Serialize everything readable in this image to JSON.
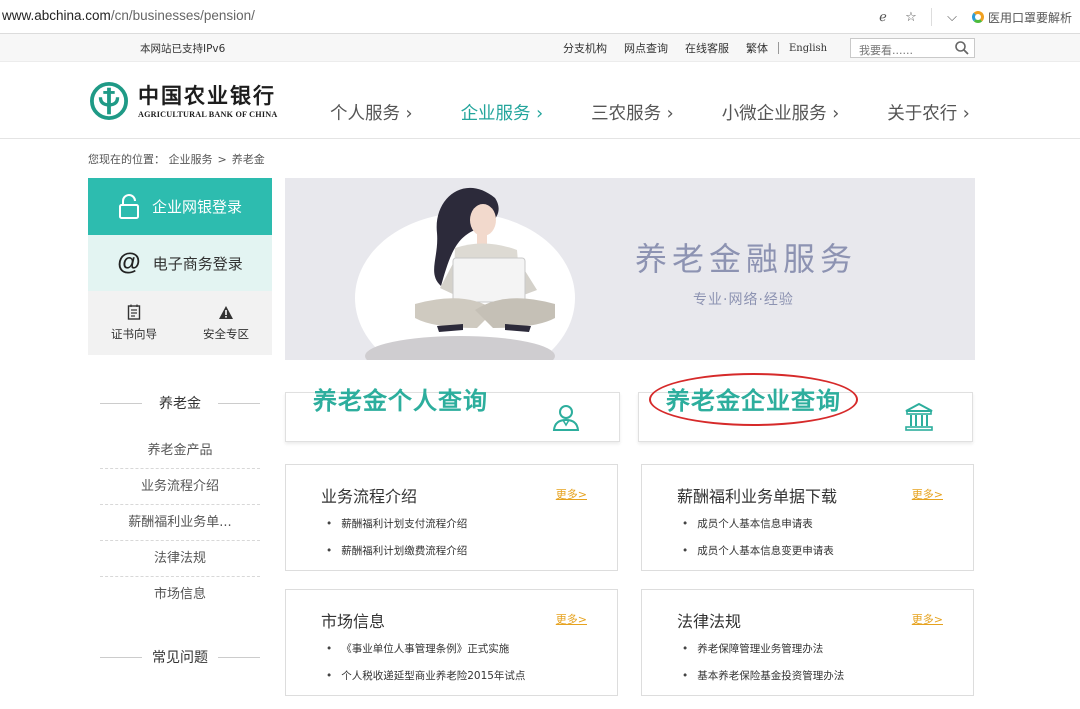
{
  "browser": {
    "url_host": "www.abchina.com",
    "url_path": "/cn/businesses/pension/",
    "search_hint": "医用口罩要解析"
  },
  "topbar": {
    "ipv6": "本网站已支持IPv6",
    "links": [
      "分支机构",
      "网点查询",
      "在线客服",
      "繁体"
    ],
    "english": "English",
    "search_placeholder": "我要看......"
  },
  "header": {
    "logo_cn": "中国农业银行",
    "logo_en": "AGRICULTURAL BANK OF CHINA",
    "nav": [
      {
        "label": "个人服务 ›",
        "active": false
      },
      {
        "label": "企业服务 ›",
        "active": true
      },
      {
        "label": "三农服务 ›",
        "active": false
      },
      {
        "label": "小微企业服务 ›",
        "active": false
      },
      {
        "label": "关于农行 ›",
        "active": false
      }
    ]
  },
  "breadcrumb": {
    "prefix": "您现在的位置：",
    "items": [
      "企业服务",
      "养老金"
    ],
    "separator": ">"
  },
  "sidebar": {
    "ebank_login": "企业网银登录",
    "ecommerce_login": "电子商务登录",
    "quick_links": [
      "证书向导",
      "安全专区"
    ],
    "section_title": "养老金",
    "menu": [
      "养老金产品",
      "业务流程介绍",
      "薪酬福利业务单...",
      "法律法规",
      "市场信息"
    ],
    "faq_title": "常见问题"
  },
  "banner": {
    "title": "养老金融服务",
    "subtitle": "专业·网络·经验"
  },
  "query_cards": [
    {
      "title": "养老金个人查询",
      "icon": "person-icon"
    },
    {
      "title": "养老金企业查询",
      "icon": "bank-building-icon"
    }
  ],
  "info_boxes": [
    {
      "title": "业务流程介绍",
      "more": "更多>",
      "items": [
        "薪酬福利计划支付流程介绍",
        "薪酬福利计划缴费流程介绍"
      ]
    },
    {
      "title": "薪酬福利业务单据下载",
      "more": "更多>",
      "items": [
        "成员个人基本信息申请表",
        "成员个人基本信息变更申请表"
      ]
    },
    {
      "title": "市场信息",
      "more": "更多>",
      "items": [
        "《事业单位人事管理条例》正式实施",
        "个人税收递延型商业养老险2015年试点"
      ]
    },
    {
      "title": "法律法规",
      "more": "更多>",
      "items": [
        "养老保障管理业务管理办法",
        "基本养老保险基金投资管理办法"
      ]
    }
  ],
  "colors": {
    "brand_teal": "#2dbcaf",
    "nav_active": "#24a59c",
    "more_link": "#e6a21e",
    "highlight_ellipse": "#d62a2a"
  }
}
